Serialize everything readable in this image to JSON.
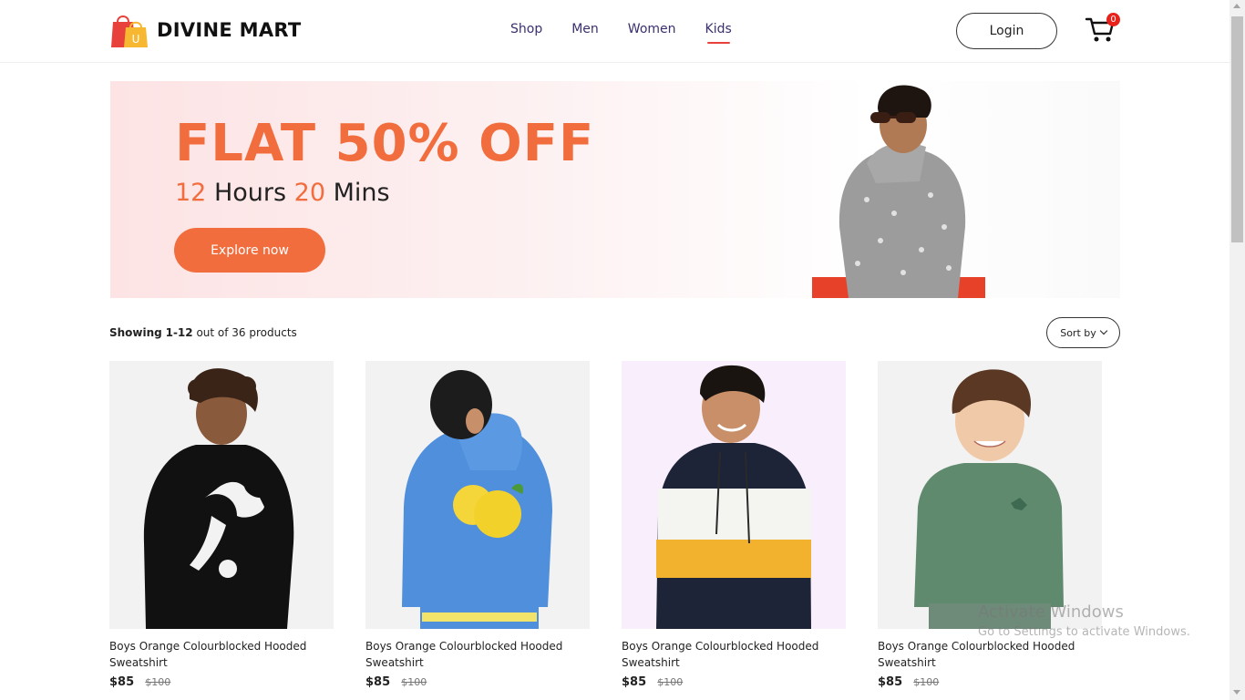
{
  "header": {
    "brand": "DIVINE MART",
    "logo_letter": "U",
    "nav": [
      {
        "label": "Shop",
        "active": false
      },
      {
        "label": "Men",
        "active": false
      },
      {
        "label": "Women",
        "active": false
      },
      {
        "label": "Kids",
        "active": true
      }
    ],
    "login_label": "Login",
    "cart_count": "0",
    "cart_icon": "shopping-cart-icon"
  },
  "banner": {
    "title": "FLAT 50% OFF",
    "hours_value": "12",
    "hours_label": "Hours",
    "mins_value": "20",
    "mins_label": "Mins",
    "cta_label": "Explore now",
    "accent_color": "#f26d3d"
  },
  "listing": {
    "showing_prefix": "Showing",
    "showing_range": "1-12",
    "showing_suffix": "out of 36 products",
    "sort_label": "Sort by"
  },
  "products": [
    {
      "name": "Boys Orange Colourblocked Hooded Sweatshirt",
      "price": "$85",
      "old_price": "$100"
    },
    {
      "name": "Boys Orange Colourblocked Hooded Sweatshirt",
      "price": "$85",
      "old_price": "$100"
    },
    {
      "name": "Boys Orange Colourblocked Hooded Sweatshirt",
      "price": "$85",
      "old_price": "$100"
    },
    {
      "name": "Boys Orange Colourblocked Hooded Sweatshirt",
      "price": "$85",
      "old_price": "$100"
    }
  ],
  "watermark": {
    "title": "Activate Windows",
    "subtitle": "Go to Settings to activate Windows."
  }
}
